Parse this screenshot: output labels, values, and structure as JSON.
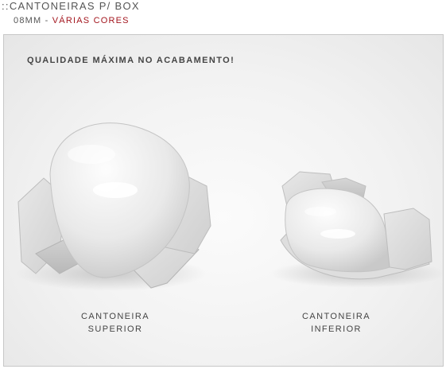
{
  "header": {
    "title": "::CANTONEIRAS P/ BOX",
    "subtitle_size": "08MM",
    "subtitle_separator": " - ",
    "subtitle_colors": "VÁRIAS CORES"
  },
  "photo": {
    "tagline": "QUALIDADE MÁXIMA NO ACABAMENTO!",
    "products": [
      {
        "caption_line1": "CANTONEIRA",
        "caption_line2": "SUPERIOR"
      },
      {
        "caption_line1": "CANTONEIRA",
        "caption_line2": "INFERIOR"
      }
    ]
  },
  "colors": {
    "accent": "#a3161e",
    "text": "#555555"
  }
}
